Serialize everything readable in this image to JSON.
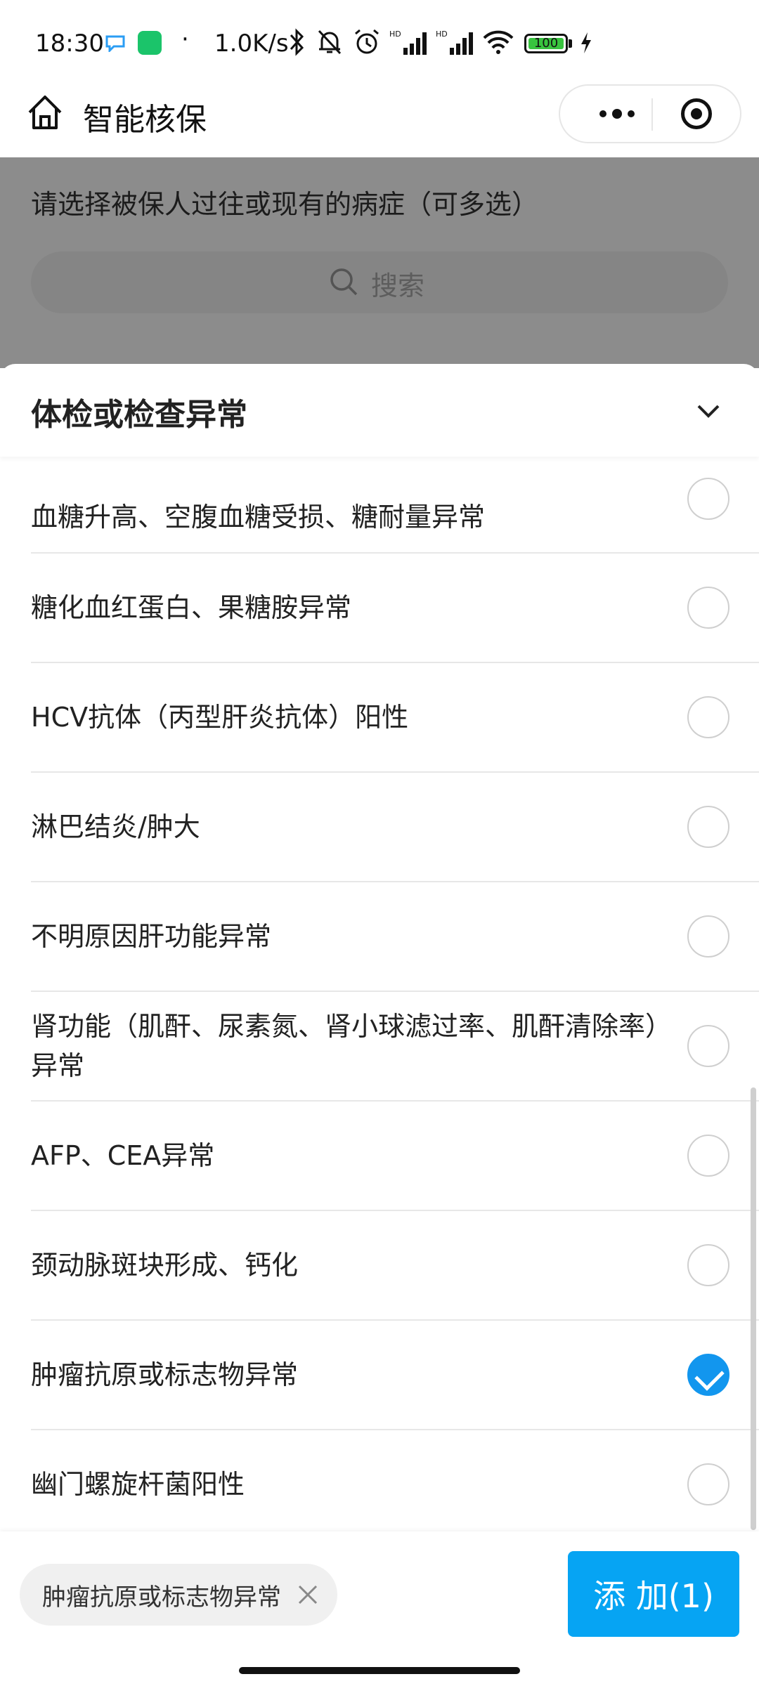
{
  "status_bar": {
    "time": "18:30",
    "separator": "·",
    "net_speed": "1.0K/s",
    "battery": "100"
  },
  "titlebar": {
    "title": "智能核保",
    "icons": [
      "home-icon",
      "more-icon",
      "target-icon"
    ]
  },
  "background_page": {
    "prompt": "请选择被保人过往或现有的病症（可多选）",
    "search_placeholder": "搜索"
  },
  "sheet": {
    "title": "体检或检查异常",
    "items": [
      {
        "label": "血糖升高、空腹血糖受损、糖耐量异常",
        "selected": false
      },
      {
        "label": "糖化血红蛋白、果糖胺异常",
        "selected": false
      },
      {
        "label": "HCV抗体（丙型肝炎抗体）阳性",
        "selected": false
      },
      {
        "label": "淋巴结炎/肿大",
        "selected": false
      },
      {
        "label": "不明原因肝功能异常",
        "selected": false
      },
      {
        "label": "肾功能（肌酐、尿素氮、肾小球滤过率、肌酐清除率）异常",
        "selected": false
      },
      {
        "label": "AFP、CEA异常",
        "selected": false
      },
      {
        "label": "颈动脉斑块形成、钙化",
        "selected": false
      },
      {
        "label": "肿瘤抗原或标志物异常",
        "selected": true
      },
      {
        "label": "幽门螺旋杆菌阳性",
        "selected": false
      }
    ]
  },
  "bottom_bar": {
    "selected_chip": "肿瘤抗原或标志物异常",
    "add_button": "添 加(1)"
  },
  "colors": {
    "accent": "#06a4f3",
    "check": "#1296ee"
  }
}
